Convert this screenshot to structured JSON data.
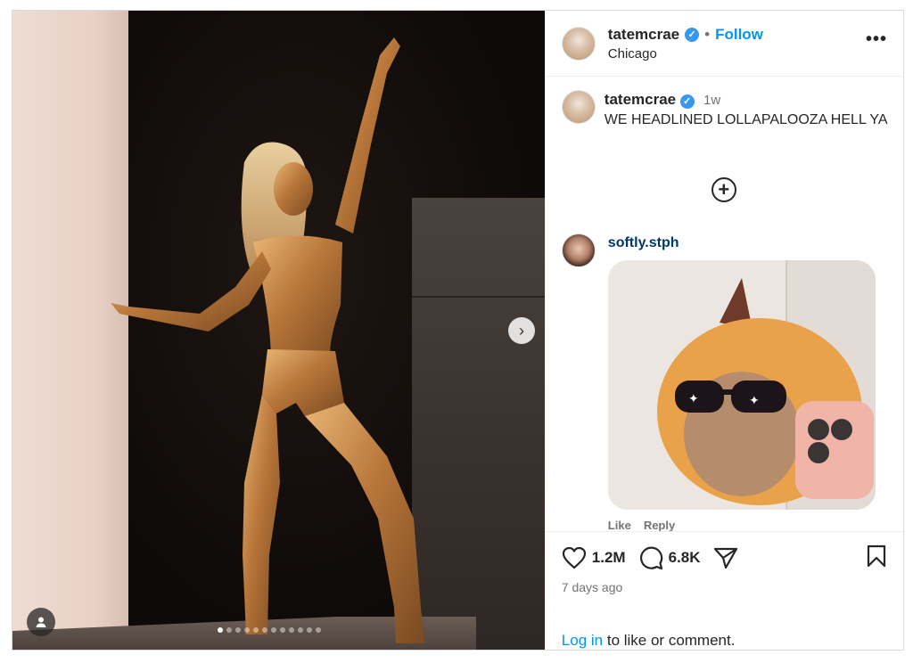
{
  "post": {
    "username": "tatemcrae",
    "follow_label": "Follow",
    "separator": "•",
    "location": "Chicago",
    "more_label": "•••",
    "verified_mark": "✓"
  },
  "media": {
    "next_label": "›",
    "slide_count": 12,
    "active_slide": 1
  },
  "caption": {
    "username": "tatemcrae",
    "time": "1w",
    "text": "WE HEADLINED LOLLAPALOOZA HELL YA"
  },
  "load_more_label": "+",
  "comment": {
    "username": "softly.stph",
    "like_label": "Like",
    "reply_label": "Reply"
  },
  "actions": {
    "likes": "1.2M",
    "comments": "6.8K"
  },
  "timestamp": "7 days ago",
  "login": {
    "link": "Log in",
    "rest": " to like or comment."
  },
  "colors": {
    "accent": "#0095f6",
    "verified": "#3897f0",
    "text": "#262626",
    "muted": "#737373",
    "gold": "#c8893f"
  },
  "icons": [
    "user-tag-icon",
    "chevron-right-icon",
    "more-icon",
    "plus-circle-icon",
    "heart-icon",
    "comment-icon",
    "share-icon",
    "bookmark-icon",
    "verified-icon"
  ]
}
